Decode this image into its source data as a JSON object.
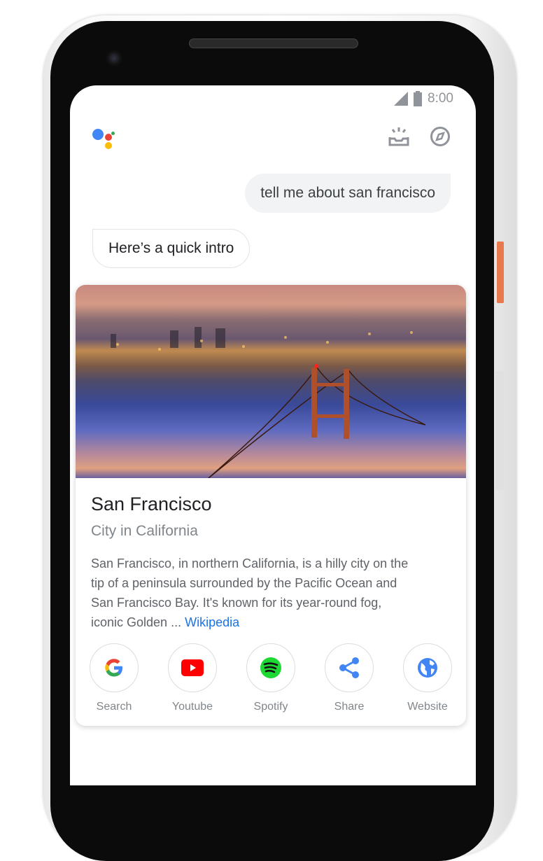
{
  "status_bar": {
    "time": "8:00",
    "signal_icon": "signal-icon",
    "battery_icon": "battery-icon"
  },
  "header": {
    "logo": "google-assistant-logo",
    "icons": [
      "updates-tray-icon",
      "explore-compass-icon"
    ]
  },
  "conversation": {
    "user_message": "tell me about san francisco",
    "assistant_message": "Here’s a quick intro"
  },
  "card": {
    "title": "San Francisco",
    "subtitle": "City in California",
    "description": "San Francisco, in northern California, is a hilly city on the tip of a peninsula surrounded by the Pacific Ocean and San Francisco Bay. It's known for its year-round fog, iconic Golden ... ",
    "source_link": "Wikipedia",
    "actions": [
      {
        "label": "Search",
        "icon": "google-icon"
      },
      {
        "label": "Youtube",
        "icon": "youtube-icon"
      },
      {
        "label": "Spotify",
        "icon": "spotify-icon"
      },
      {
        "label": "Share",
        "icon": "share-icon"
      },
      {
        "label": "Website",
        "icon": "globe-icon"
      }
    ]
  },
  "colors": {
    "accent": "#1a73e8",
    "user_bubble": "#f1f3f4",
    "icon_gray": "#909399"
  }
}
